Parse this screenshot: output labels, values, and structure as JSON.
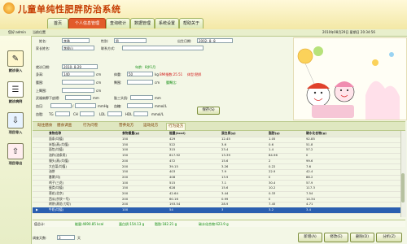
{
  "app": {
    "title": "儿童单纯性肥胖防治系统"
  },
  "nav_tabs": [
    {
      "label": "首页",
      "active": false
    },
    {
      "label": "个人信息管理",
      "active": true
    },
    {
      "label": "查询统计",
      "active": false
    },
    {
      "label": "数据管理",
      "active": false
    },
    {
      "label": "系统设置",
      "active": false
    },
    {
      "label": "帮助关于",
      "active": false
    }
  ],
  "statusbar": {
    "login": "您好:admin",
    "location": "当前位置",
    "datetime": "2010年08月29日 星期日 20:34:56",
    "menu": "菜单"
  },
  "sidebar": {
    "items": [
      {
        "label": "就诊录入",
        "icon": "pencil-icon"
      },
      {
        "label": "就诊病例",
        "icon": "document-icon"
      },
      {
        "label": "项目导入",
        "icon": "import-icon"
      },
      {
        "label": "项目导出",
        "icon": "export-icon"
      }
    ]
  },
  "form": {
    "name_label": "姓名:",
    "name_value": "李勇",
    "gender_label": "性别:",
    "gender_value": "男",
    "birth_label": "出生日期:",
    "birth_value": "2002- 8- 8",
    "parent_label": "家长姓名:",
    "parent_value": "李俊山",
    "contact_label": "联系方式:",
    "contact_value": "",
    "visit_label": "就诊日期:",
    "visit_value": "2010- 8-29",
    "age_label": "年龄:",
    "age_value": "8岁1月",
    "height_label": "身高:",
    "height_value": "140",
    "height_unit": "cm",
    "weight_label": "体重:",
    "weight_value": "50",
    "weight_unit": "kg",
    "bmi_text": "BMI指数:25.51",
    "bodytype_text": "体型:肥胖",
    "waist_label": "腰围:",
    "waist_unit": "cm",
    "hip_label": "臀围:",
    "hip_unit": "cm",
    "waist_hip_label": "腰臀比:",
    "arm_label": "上臂围:",
    "arm_unit": "cm",
    "skinfold_label": "武福肩胛下皮褶:",
    "skinfold_unit": "mm",
    "triceps_label": "肱三头肌:",
    "triceps_unit": "mm",
    "bp_label": "血压:",
    "bp_unit": "mmHg",
    "glucose_label": "血糖:",
    "glucose_unit": "mmol/L",
    "lipid_label": "血脂:",
    "tg_label": "TG",
    "tc_label": "CH",
    "ldl_label": "LDL",
    "hdl_label": "HDL",
    "lipid_unit": "mmol/L",
    "save_button": "保存(S)"
  },
  "subtabs": [
    "既往膳食",
    "膳食调查",
    "行为问卷",
    "营养处方",
    "运动处方",
    "行为处方"
  ],
  "table": {
    "headers": [
      "食物名称",
      "食物重量(g)",
      "能量(kcal)",
      "蛋白质(g)",
      "脂肪(g)",
      "碳水化合物(g)"
    ],
    "rows": [
      [
        "面条(均值)",
        "150",
        "429",
        "12.45",
        "1.05",
        "92.85"
      ],
      [
        "米饭(蒸)(均值)",
        "150",
        "522",
        "3.6",
        "0.6",
        "51.8"
      ],
      [
        "面包(均值)",
        "100",
        "315",
        "23.4",
        "1.4",
        "57.2"
      ],
      [
        "油炸(油条类)",
        "150",
        "617.92",
        "13.39",
        "84.96",
        "0"
      ],
      [
        "馒头(蒸)(均值)",
        "200",
        "472",
        "15.6",
        "2",
        "99.6"
      ],
      [
        "大白菜(均值)",
        "200",
        "39.15",
        "3.26",
        "0.22",
        "7.6"
      ],
      [
        "油饼",
        "150",
        "403",
        "7.9",
        "22.9",
        "42.4"
      ],
      [
        "番薯(均)",
        "200",
        "408",
        "13.9",
        "0",
        "88.2"
      ],
      [
        "鸡子(三花)",
        "100",
        "515",
        "7.1",
        "30.4",
        "57.9"
      ],
      [
        "蛋类(均值)",
        "150",
        "628",
        "15.6",
        "10.2",
        "117.3"
      ],
      [
        "葱花(北京)",
        "200",
        "42.64",
        "3.44",
        "0.33",
        "7.54"
      ],
      [
        "西瓜(京欣一号)",
        "200",
        "60.16",
        "0.99",
        "0",
        "14.34"
      ],
      [
        "烤饼(蒸馅·刀切)",
        "200",
        "193.54",
        "28.9",
        "7.45",
        "4.71"
      ],
      [
        "牛奶(均值)",
        "100",
        "54",
        "3",
        "3.2",
        "3.4"
      ]
    ],
    "selected_index": 13,
    "row_indicator": "▶"
  },
  "summary": {
    "label": "值总计:",
    "energy": "能量:4690.85 kcal",
    "protein": "蛋白质:154.13 g",
    "fat": "脂肪:182.21 g",
    "carb": "碳水化合物:623.9 g"
  },
  "footer": {
    "days_label": "调查天数:",
    "days_value": "3",
    "days_unit": "天",
    "buttons": [
      "新增(A)",
      "修改(E)",
      "删除(D)",
      "分析(Z)"
    ]
  },
  "colors": {
    "active_tab": "#e25b2b",
    "selected_row": "#2a5fb0",
    "title": "#c53b00"
  }
}
